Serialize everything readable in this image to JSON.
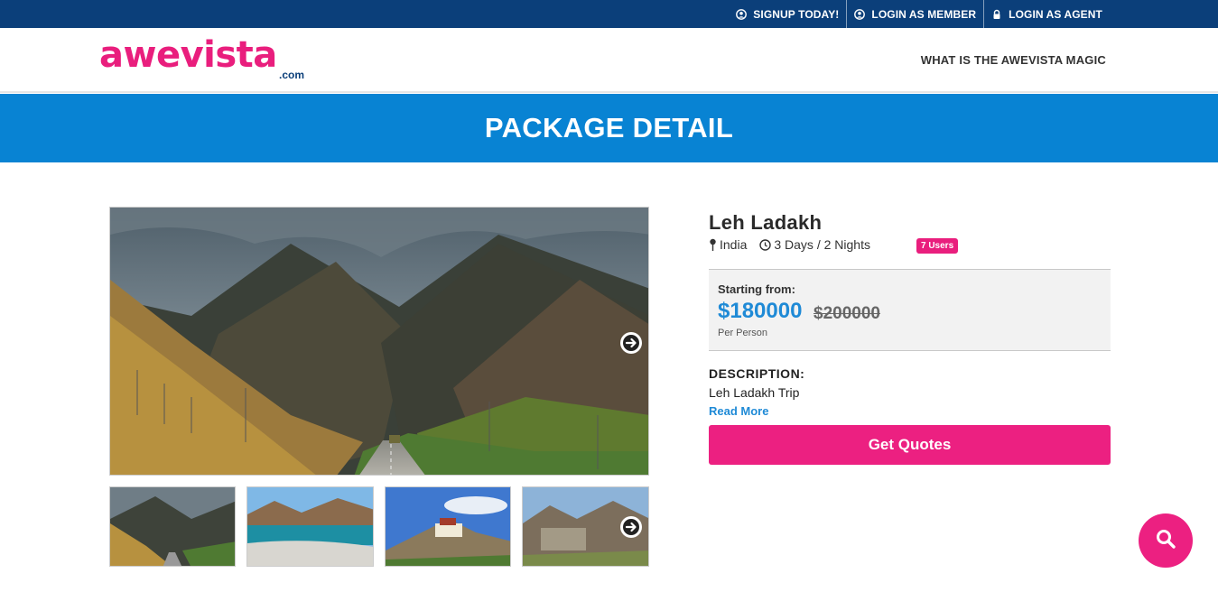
{
  "topbar": {
    "signup_label": "SIGNUP TODAY!",
    "login_member_label": "LOGIN AS MEMBER",
    "login_agent_label": "LOGIN AS AGENT"
  },
  "header": {
    "logo_text": "awevista",
    "logo_suffix": ".com",
    "nav_magic": "WHAT IS THE AWEVISTA MAGIC"
  },
  "banner": {
    "title": "PACKAGE DETAIL"
  },
  "package": {
    "name": "Leh Ladakh",
    "location": "India",
    "duration": "3 Days / 2 Nights",
    "users_badge": "7 Users",
    "starting_label": "Starting from:",
    "price": "$180000",
    "old_price": "$200000",
    "per_person": "Per Person",
    "description_heading": "DESCRIPTION:",
    "description_text": "Leh Ladakh Trip",
    "read_more": "Read More",
    "cta": "Get Quotes"
  },
  "colors": {
    "topbar": "#0b3f7a",
    "banner": "#0883d3",
    "brand_pink": "#e91e7d",
    "price_blue": "#1f8ad6"
  },
  "icons": {
    "signup": "user-circle-icon",
    "login_member": "user-circle-icon",
    "login_agent": "lock-icon",
    "location": "map-pin-icon",
    "duration": "clock-icon",
    "gallery_next": "arrow-right-circle-icon",
    "search": "search-icon"
  }
}
